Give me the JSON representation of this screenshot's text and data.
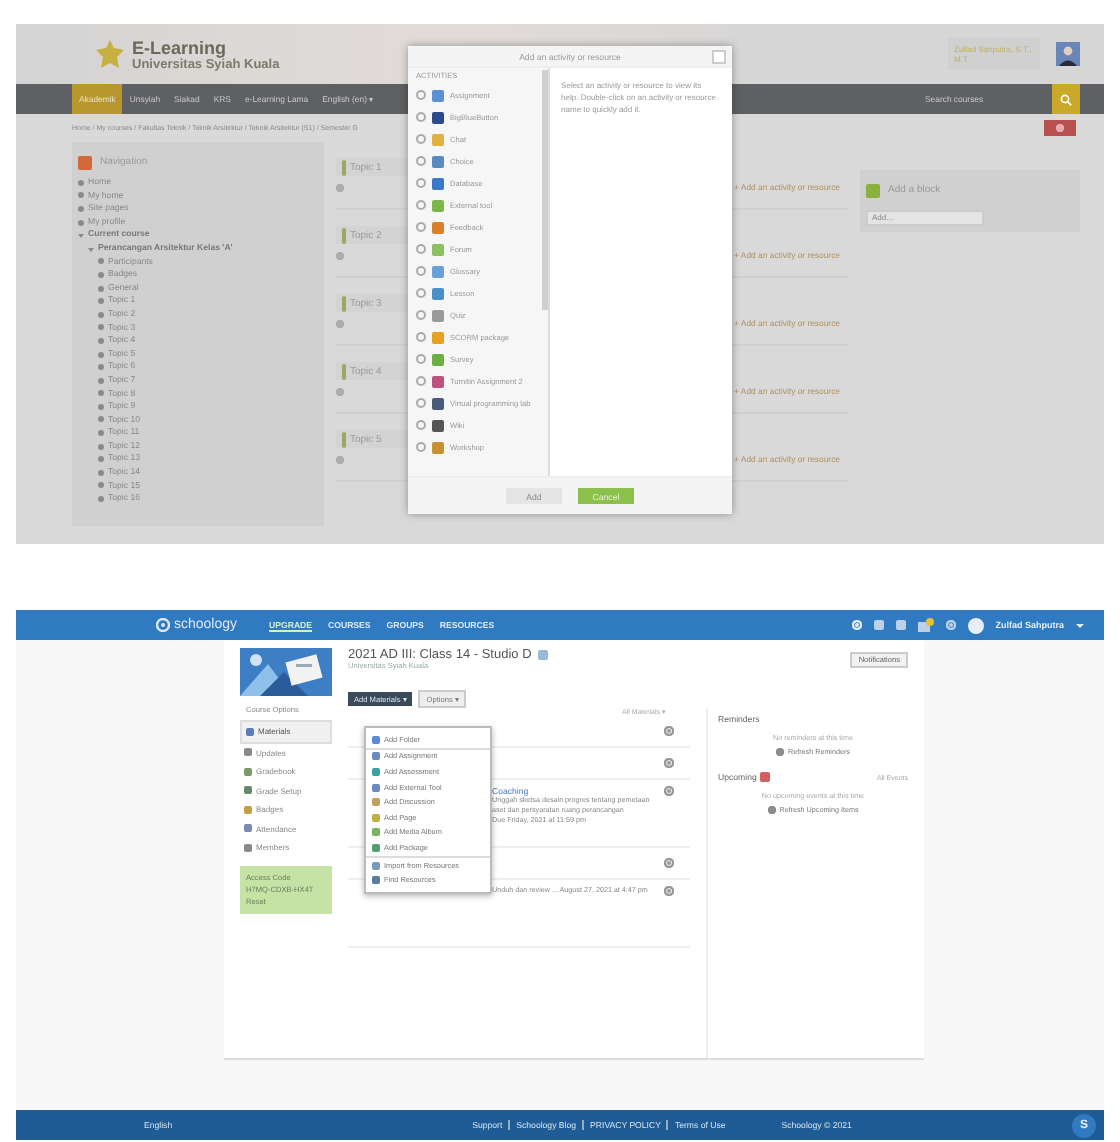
{
  "moodle": {
    "site_title": "E-Learning",
    "site_subtitle": "Universitas Syiah Kuala",
    "user_name": "Zulfad Sahputra, S.T., M.T.",
    "nav": [
      {
        "label": "Akademik",
        "selected": true
      },
      {
        "label": "Unsyiah",
        "selected": false
      },
      {
        "label": "Siakad",
        "selected": false
      },
      {
        "label": "KRS",
        "selected": false
      },
      {
        "label": "e-Learning Lama",
        "selected": false
      },
      {
        "label": "English (en) ▾",
        "selected": false
      }
    ],
    "search": {
      "placeholder": "Search courses"
    },
    "breadcrumb": "Home / My courses / Fakultas Teknik / Teknik Arsitektur / Teknik Arsitektur (S1) / Semester G",
    "navigation": {
      "title": "Navigation",
      "items": [
        {
          "label": "Home"
        },
        {
          "label": "My home"
        },
        {
          "label": "Site pages"
        },
        {
          "label": "My profile"
        },
        {
          "label": "Current course",
          "children": [
            {
              "label": "Perancangan Arsitektur Kelas 'A'",
              "children": [
                {
                  "label": "Participants"
                },
                {
                  "label": "Badges"
                },
                {
                  "label": "General"
                },
                {
                  "label": "Topic 1"
                },
                {
                  "label": "Topic 2"
                },
                {
                  "label": "Topic 3"
                },
                {
                  "label": "Topic 4"
                },
                {
                  "label": "Topic 5"
                },
                {
                  "label": "Topic 6"
                },
                {
                  "label": "Topic 7"
                },
                {
                  "label": "Topic 8"
                },
                {
                  "label": "Topic 9"
                },
                {
                  "label": "Topic 10"
                },
                {
                  "label": "Topic 11"
                },
                {
                  "label": "Topic 12"
                },
                {
                  "label": "Topic 13"
                },
                {
                  "label": "Topic 14"
                },
                {
                  "label": "Topic 15"
                },
                {
                  "label": "Topic 16"
                }
              ]
            }
          ]
        }
      ]
    },
    "sections": [
      {
        "title": "Topic 1",
        "add_link": "+ Add an activity or resource"
      },
      {
        "title": "Topic 2",
        "add_link": "+ Add an activity or resource"
      },
      {
        "title": "Topic 3",
        "add_link": "+ Add an activity or resource"
      },
      {
        "title": "Topic 4",
        "add_link": "+ Add an activity or resource"
      },
      {
        "title": "Topic 5",
        "add_link": "+ Add an activity or resource"
      }
    ],
    "add_block": {
      "title": "Add a block",
      "select": "Add..."
    },
    "modal": {
      "title": "Add an activity or resource",
      "group": "ACTIVITIES",
      "activities": [
        {
          "label": "Assignment",
          "selected": false
        },
        {
          "label": "BigBlueButton",
          "selected": false
        },
        {
          "label": "Chat",
          "selected": false
        },
        {
          "label": "Choice",
          "selected": false
        },
        {
          "label": "Database",
          "selected": false
        },
        {
          "label": "External tool",
          "selected": false
        },
        {
          "label": "Feedback",
          "selected": false
        },
        {
          "label": "Forum",
          "selected": false
        },
        {
          "label": "Glossary",
          "selected": false
        },
        {
          "label": "Lesson",
          "selected": false
        },
        {
          "label": "Quiz",
          "selected": false
        },
        {
          "label": "SCORM package",
          "selected": false
        },
        {
          "label": "Survey",
          "selected": false
        },
        {
          "label": "Turnitin Assignment 2",
          "selected": false
        },
        {
          "label": "Virtual programming lab",
          "selected": false
        },
        {
          "label": "Wiki",
          "selected": false
        },
        {
          "label": "Workshop",
          "selected": false
        }
      ],
      "help": "Select an activity or resource to view its help. Double-click on an activity or resource name to quickly add it.",
      "buttons": [
        {
          "label": "Add",
          "disabled": true
        },
        {
          "label": "Cancel",
          "disabled": false
        }
      ]
    }
  },
  "schoology": {
    "brand": "schoology",
    "nav": [
      {
        "label": "UPGRADE",
        "selected": true
      },
      {
        "label": "COURSES",
        "selected": false
      },
      {
        "label": "GROUPS",
        "selected": false
      },
      {
        "label": "RESOURCES",
        "selected": false
      }
    ],
    "user_name": "Zulfad Sahputra",
    "course_title": "2021 AD III: Class 14 - Studio D",
    "course_subtitle": "Universitas Syiah Kuala",
    "notifications_button": "Notifications",
    "course_options": "Course Options",
    "menu": [
      {
        "label": "Materials",
        "selected": true
      },
      {
        "label": "Updates",
        "selected": false
      },
      {
        "label": "Gradebook",
        "selected": false
      },
      {
        "label": "Grade Setup",
        "selected": false
      },
      {
        "label": "Badges",
        "selected": false
      },
      {
        "label": "Attendance",
        "selected": false
      },
      {
        "label": "Members",
        "selected": false
      }
    ],
    "access_code": {
      "title": "Access Code",
      "code": "H7MQ-CDXB-HX4T",
      "note": "Reset"
    },
    "add_materials": "Add Materials ▾",
    "options": "Options ▾",
    "filter": "All Materials ▾",
    "dropdown": [
      "Add Folder",
      "Add Assignment",
      "Add Assessment",
      "Add External Tool",
      "Add Discussion",
      "Add Page",
      "Add Media Album",
      "Add Package",
      "Import from Resources",
      "Find Resources"
    ],
    "materials": [
      {
        "kind": "covered"
      },
      {
        "kind": "covered"
      },
      {
        "kind": "item",
        "title": "Coaching",
        "description": "Unggah sketsa desain progres tentang pemetaan aset dan persyaratan ruang perancangan",
        "due": "Due Friday, 2021 at 11:59 pm"
      },
      {
        "kind": "covered"
      },
      {
        "kind": "item",
        "description": "Unduh dan review ... August 27, 2021 at 4:47 pm"
      }
    ],
    "reminders": {
      "title": "Reminders",
      "empty": "No reminders at this time",
      "refresh": "Refresh Reminders"
    },
    "upcoming": {
      "title": "Upcoming",
      "all": "All Events",
      "empty": "No upcoming events at this time",
      "refresh": "Refresh Upcoming Items"
    },
    "footer": {
      "language": "English",
      "links": [
        "Support",
        "Schoology Blog",
        "PRIVACY POLICY",
        "Terms of Use"
      ],
      "copyright": "Schoology © 2021",
      "help": "S"
    }
  }
}
